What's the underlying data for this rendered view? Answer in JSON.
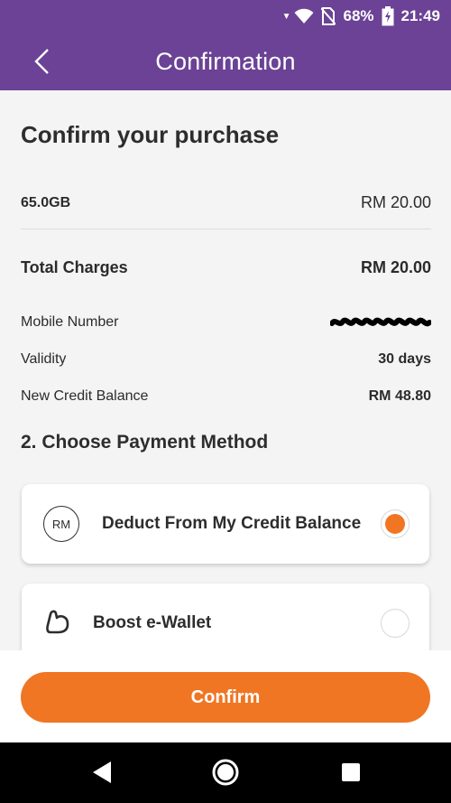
{
  "status_bar": {
    "battery_percent": "68%",
    "time": "21:49",
    "icons": [
      "signal-arrows-icon",
      "wifi-icon",
      "no-sim-icon",
      "battery-charging-icon"
    ]
  },
  "app_bar": {
    "title": "Confirmation",
    "back_icon": "chevron-left-icon"
  },
  "summary": {
    "heading": "Confirm your purchase",
    "plan": {
      "label": "65.0GB",
      "price": "RM 20.00"
    },
    "total": {
      "label": "Total Charges",
      "value": "RM 20.00"
    },
    "mobile_number": {
      "label": "Mobile Number"
    },
    "validity": {
      "label": "Validity",
      "value": "30 days"
    },
    "new_credit_balance": {
      "label": "New Credit Balance",
      "value": "RM 48.80"
    }
  },
  "payment": {
    "section_title": "2. Choose Payment Method",
    "methods": [
      {
        "icon_text": "RM",
        "icon": "rm-circle-icon",
        "label": "Deduct From My Credit Balance",
        "selected": true
      },
      {
        "icon": "boost-wallet-icon",
        "label": "Boost e-Wallet",
        "selected": false
      }
    ]
  },
  "footer": {
    "confirm_label": "Confirm"
  },
  "nav_bar": {
    "icons": [
      "back-triangle-icon",
      "home-circle-icon",
      "recents-square-icon"
    ]
  },
  "colors": {
    "brand_purple": "#6b4295",
    "accent_orange": "#f07623"
  }
}
